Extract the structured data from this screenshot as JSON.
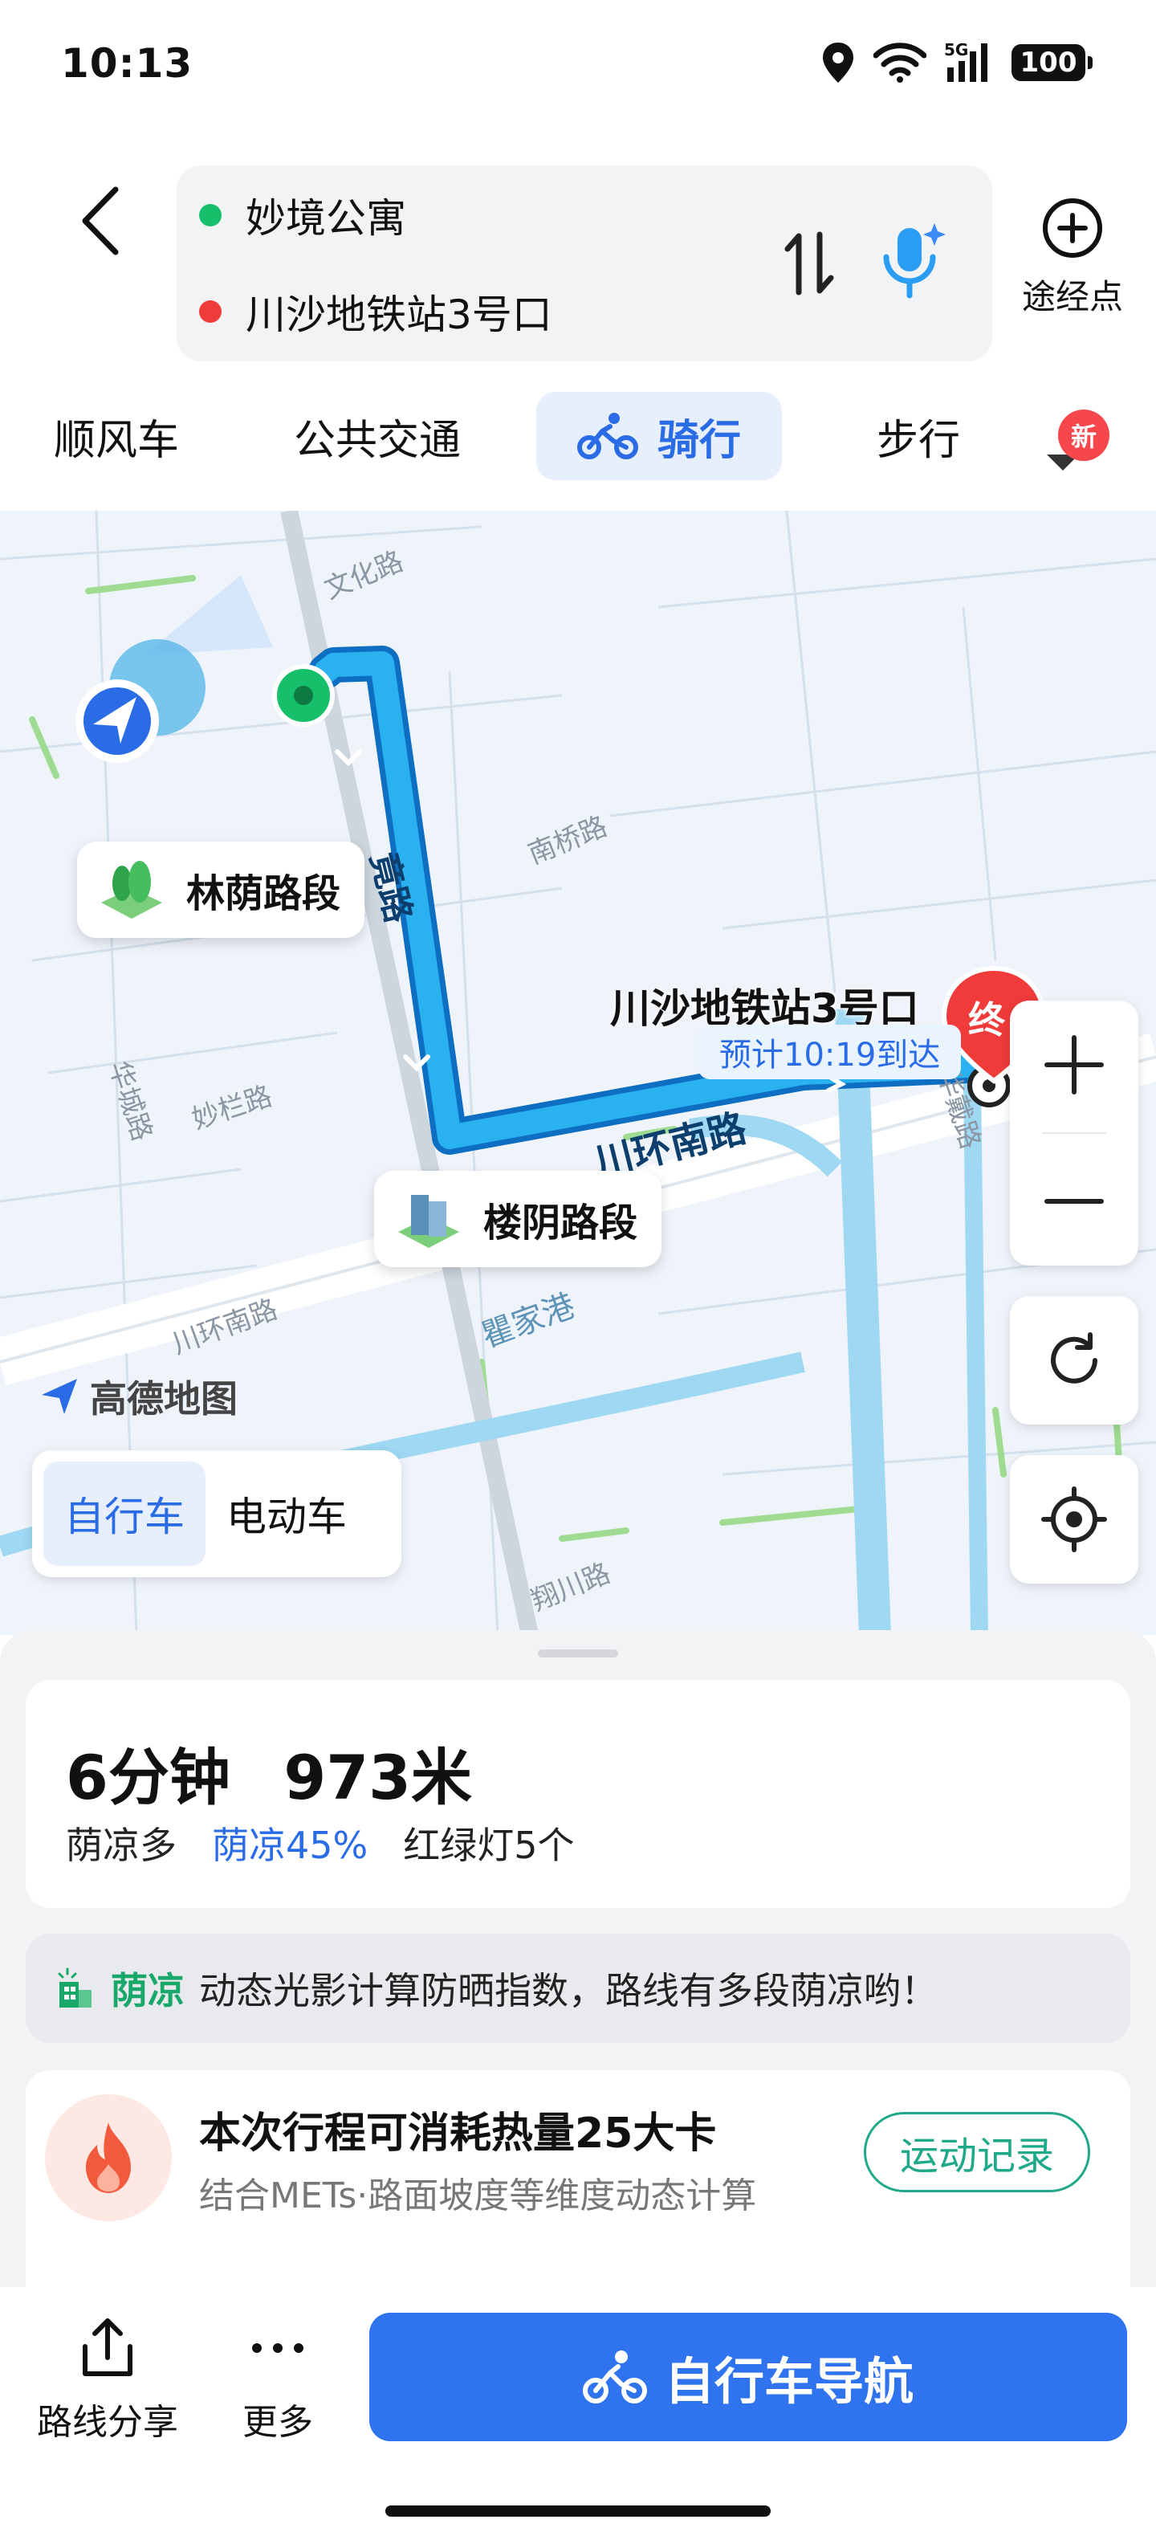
{
  "status_bar": {
    "time": "10:13",
    "network": "5G",
    "battery": "100"
  },
  "header": {
    "origin": "妙境公寓",
    "destination": "川沙地铁站3号口",
    "waypoint_label": "途经点"
  },
  "tabs": [
    {
      "label": "顺风车",
      "active": false
    },
    {
      "label": "公共交通",
      "active": false
    },
    {
      "label": "骑行",
      "active": true
    },
    {
      "label": "步行",
      "active": false
    }
  ],
  "tabs_new_badge": "新",
  "map": {
    "roads": [
      "文化路",
      "南桥路",
      "华城路",
      "妙栏路",
      "川环南路",
      "川环南路",
      "瞿家港",
      "华戴路",
      "翔川路"
    ],
    "route_label": "竟路",
    "poi_shaded": "林荫路段",
    "poi_building": "楼阴路段",
    "destination_name": "川沙地铁站3号口",
    "destination_marker": "终",
    "eta": "预计10:19到达",
    "watermark": "高德地图",
    "bike_options": [
      {
        "label": "自行车",
        "active": true
      },
      {
        "label": "电动车",
        "active": false
      }
    ],
    "accent_color": "#2a6be6",
    "route_color": "#1e9be8"
  },
  "summary": {
    "duration": "6分钟",
    "distance": "973米",
    "shade_level": "荫凉多",
    "shade_percent": "荫凉45%",
    "traffic_lights": "红绿灯5个"
  },
  "shade_banner": {
    "tag": "荫凉",
    "text": "动态光影计算防晒指数，路线有多段荫凉哟！"
  },
  "calorie": {
    "title": "本次行程可消耗热量25大卡",
    "subtitle": "结合METs·路面坡度等维度动态计算",
    "record_button": "运动记录"
  },
  "bottom_bar": {
    "share_label": "路线分享",
    "more_label": "更多",
    "nav_button": "自行车导航"
  }
}
